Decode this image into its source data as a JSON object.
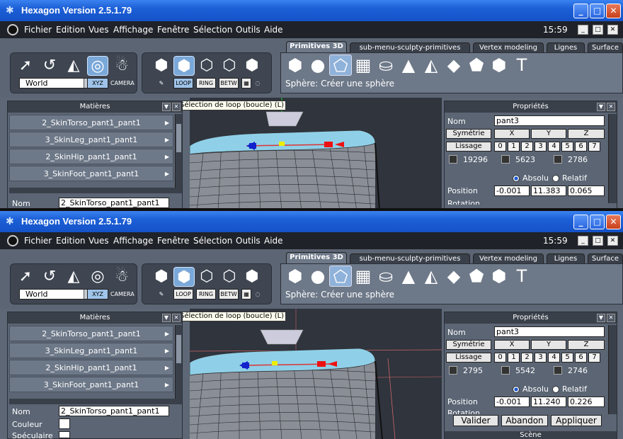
{
  "app": {
    "title": "Hexagon Version 2.5.1.79"
  },
  "menus": [
    "Fichier",
    "Edition",
    "Vues",
    "Affichage",
    "Fenêtre",
    "Sélection",
    "Outils",
    "Aide"
  ],
  "clock": "15:59",
  "toolbar": {
    "world_label": "World",
    "xyz_label": "XYZ",
    "camera_label": "CAMERA",
    "loop_label": "LOOP",
    "ring_label": "RING",
    "betw_label": "BETW"
  },
  "tabs": [
    "Primitives 3D",
    "sub-menu-sculpty-primitives",
    "Vertex modeling",
    "Lignes",
    "Surface"
  ],
  "status_text": "Sphère: Créer une sphère",
  "tooltip": "Sélection de loop (boucle) (L)",
  "materials_panel": {
    "title": "Matières",
    "items": [
      "2_SkinTorso_pant1_pant1",
      "3_SkinLeg_pant1_pant1",
      "2_SkinHip_pant1_pant1",
      "3_SkinFoot_pant1_pant1"
    ],
    "nom_label": "Nom",
    "nom_value": "2_SkinTorso_pant1_pant1",
    "couleur_label": "Couleur",
    "speculaire_label": "Spéculaire"
  },
  "props_panel": {
    "title": "Propriétés",
    "nom_label": "Nom",
    "nom_value": "pant3",
    "symetrie_label": "Symétrie",
    "lissage_label": "Lissage",
    "axes": [
      "X",
      "Y",
      "Z"
    ],
    "levels": [
      "0",
      "1",
      "2",
      "3",
      "4",
      "5",
      "6",
      "7"
    ],
    "absolu_label": "Absolu",
    "relatif_label": "Relatif",
    "position_label": "Position",
    "rotation_label": "Rotation"
  },
  "top_window": {
    "counts": [
      "19296",
      "5623",
      "2786"
    ],
    "position": [
      "-0.001",
      "11.383",
      "0.065"
    ]
  },
  "bottom_window": {
    "counts": [
      "2795",
      "5542",
      "2746"
    ],
    "position": [
      "-0.001",
      "11.240",
      "0.226"
    ],
    "valider": "Valider",
    "abandon": "Abandon",
    "appliquer": "Appliquer",
    "scene_title": "Scène"
  },
  "colors": {
    "accent_blue": "#1c5fd6",
    "panel": "#5b6574",
    "mesh_light": "#8fd0e8"
  }
}
